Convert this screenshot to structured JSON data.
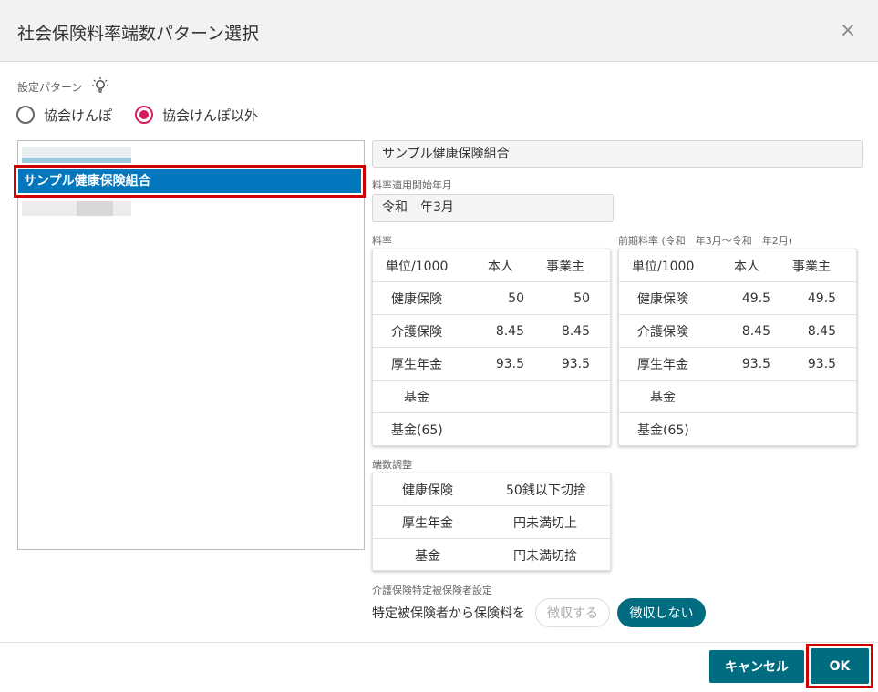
{
  "dialog": {
    "title": "社会保険料率端数パターン選択",
    "close_label": "×"
  },
  "pattern": {
    "label": "設定パターン",
    "options": [
      "協会けんぽ",
      "協会けんぽ以外"
    ],
    "selected": "協会けんぽ以外"
  },
  "list": {
    "selected_item": "サンプル健康保険組合"
  },
  "detail": {
    "name": "サンプル健康保険組合",
    "start_label": "料率適用開始年月",
    "start_value": "令和　年3月",
    "rates_label": "料率",
    "prev_rates_label": "前期料率 (令和　年3月～令和　年2月)",
    "rates_header": [
      "単位/1000",
      "本人",
      "事業主"
    ],
    "rates": [
      [
        "健康保険",
        "50",
        "50"
      ],
      [
        "介護保険",
        "8.45",
        "8.45"
      ],
      [
        "厚生年金",
        "93.5",
        "93.5"
      ],
      [
        "基金",
        "",
        ""
      ],
      [
        "基金(65)",
        "",
        ""
      ]
    ],
    "prev_rates_header": [
      "単位/1000",
      "本人",
      "事業主"
    ],
    "prev_rates": [
      [
        "健康保険",
        "49.5",
        "49.5"
      ],
      [
        "介護保険",
        "8.45",
        "8.45"
      ],
      [
        "厚生年金",
        "93.5",
        "93.5"
      ],
      [
        "基金",
        "",
        ""
      ],
      [
        "基金(65)",
        "",
        ""
      ]
    ],
    "rounding_label": "端数調整",
    "rounding": [
      [
        "健康保険",
        "50銭以下切捨"
      ],
      [
        "厚生年金",
        "円未満切上"
      ],
      [
        "基金",
        "円未満切捨"
      ]
    ],
    "kaigo_label": "介護保険特定被保険者設定",
    "kaigo_prompt": "特定被保険者から保険料を",
    "kaigo_options": [
      "徴収する",
      "徴収しない"
    ],
    "kaigo_selected": "徴収しない"
  },
  "footer": {
    "cancel_label": "キャンセル",
    "ok_label": "OK"
  },
  "colors": {
    "accent": "#006c80",
    "selection": "#0277bd",
    "radio": "#d81b60",
    "highlight": "#d00000"
  }
}
